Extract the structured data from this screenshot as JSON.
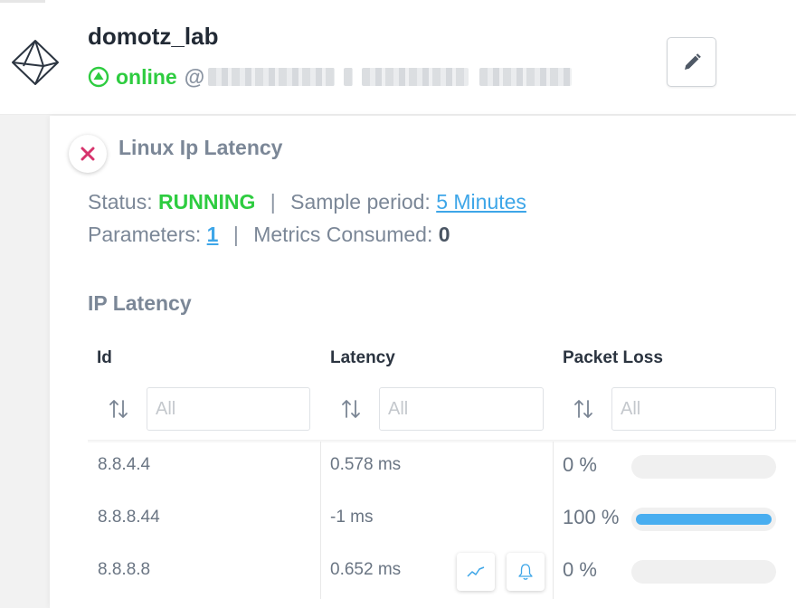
{
  "device": {
    "name": "domotz_lab",
    "status": "online",
    "at_symbol": "@",
    "logo_icon": "domotz-diamond-logo-icon",
    "online_icon": "circle-up-arrow-icon",
    "online_color": "#2ecc40"
  },
  "toolbar": {
    "edit_icon": "pencil-icon"
  },
  "driver": {
    "title": "Linux Ip Latency",
    "close_icon": "close-icon",
    "status_label": "Status:",
    "status_value": "RUNNING",
    "separator": "|",
    "sample_period_label": "Sample period:",
    "sample_period_value": "5 Minutes",
    "parameters_label": "Parameters:",
    "parameters_value": "1",
    "metrics_label": "Metrics Consumed:",
    "metrics_value": "0"
  },
  "table": {
    "title": "IP Latency",
    "columns": [
      {
        "label": "Id",
        "filter_placeholder": "All"
      },
      {
        "label": "Latency",
        "filter_placeholder": "All"
      },
      {
        "label": "Packet Loss",
        "filter_placeholder": "All"
      }
    ],
    "sort_icon": "sort-arrows-icon",
    "rows": [
      {
        "id": "8.8.4.4",
        "latency": "0.578 ms",
        "packet_loss": "0 %",
        "packet_loss_fraction": 0
      },
      {
        "id": "8.8.8.44",
        "latency": "-1 ms",
        "packet_loss": "100 %",
        "packet_loss_fraction": 1
      },
      {
        "id": "8.8.8.8",
        "latency": "0.652 ms",
        "packet_loss": "0 %",
        "packet_loss_fraction": 0
      }
    ],
    "row_actions": {
      "chart_icon": "line-chart-icon",
      "alert_icon": "bell-icon"
    },
    "bar_color": "#49aef0"
  }
}
